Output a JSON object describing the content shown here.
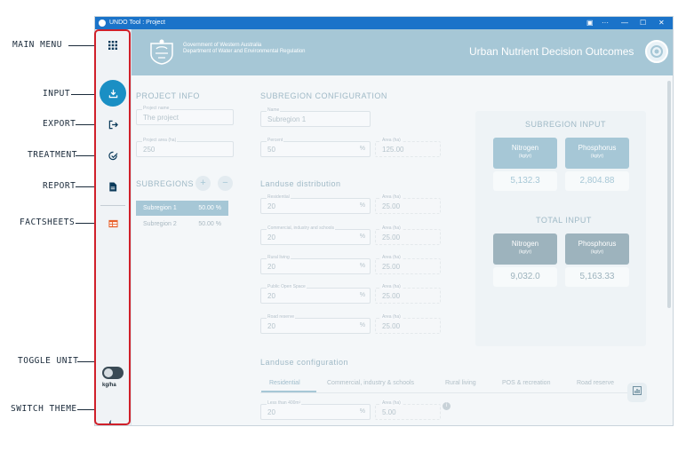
{
  "annotations": [
    "MAIN MENU",
    "INPUT",
    "EXPORT",
    "TREATMENT",
    "REPORT",
    "FACTSHEETS",
    "TOGGLE UNIT",
    "SWITCH THEME"
  ],
  "window": {
    "title": "UNDO Tool : Project"
  },
  "sidebar": {
    "toggle_label": "kg/ha"
  },
  "header": {
    "gov_line1": "Government of Western Australia",
    "gov_line2": "Department of Water and Environmental Regulation",
    "app_title": "Urban Nutrient Decision Outcomes"
  },
  "project": {
    "title": "PROJECT INFO",
    "name_label": "Project name",
    "name_value": "The project",
    "area_label": "Project area (ha)",
    "area_value": "250"
  },
  "subregions": {
    "title": "SUBREGIONS",
    "items": [
      {
        "name": "Subregion 1",
        "percent": "50.00 %"
      },
      {
        "name": "Subregion 2",
        "percent": "50.00 %"
      }
    ]
  },
  "subregion_config": {
    "title": "SUBREGION CONFIGURATION",
    "name_label": "Name",
    "name_value": "Subregion 1",
    "percent_label": "Percent",
    "percent_value": "50",
    "area_label": "Area (ha)",
    "area_value": "125.00",
    "pct_sign": "%"
  },
  "landuse_distribution": {
    "title": "Landuse distribution",
    "area_label": "Area (ha)",
    "rows": [
      {
        "label": "Residential",
        "value": "20",
        "area": "25.00"
      },
      {
        "label": "Commercial, industry and schools",
        "value": "20",
        "area": "25.00"
      },
      {
        "label": "Rural living",
        "value": "20",
        "area": "25.00"
      },
      {
        "label": "Public Open Space",
        "value": "20",
        "area": "25.00"
      },
      {
        "label": "Road reserve",
        "value": "20",
        "area": "25.00"
      }
    ]
  },
  "subregion_input": {
    "title": "SUBREGION INPUT",
    "nitrogen_label": "Nitrogen",
    "phosphorus_label": "Phosphorus",
    "unit": "(kg/yr)",
    "nitrogen_value": "5,132.3",
    "phosphorus_value": "2,804.88"
  },
  "total_input": {
    "title": "TOTAL INPUT",
    "nitrogen_label": "Nitrogen",
    "phosphorus_label": "Phosphorus",
    "unit": "(kg/yr)",
    "nitrogen_value": "9,032.0",
    "phosphorus_value": "5,163.33"
  },
  "landuse_configuration": {
    "title": "Landuse configuration",
    "tabs": [
      "Residential",
      "Commercial, industry & schools",
      "Rural living",
      "POS & recreation",
      "Road reserve"
    ],
    "field_label": "Less than 400m²",
    "field_value": "20",
    "area_label": "Area (ha)",
    "area_value": "5.00"
  },
  "colors": {
    "accent": "#a6c7d6",
    "active": "#1a8fc4",
    "total_header": "#9db3bd",
    "annotation_box": "#d0202a"
  }
}
